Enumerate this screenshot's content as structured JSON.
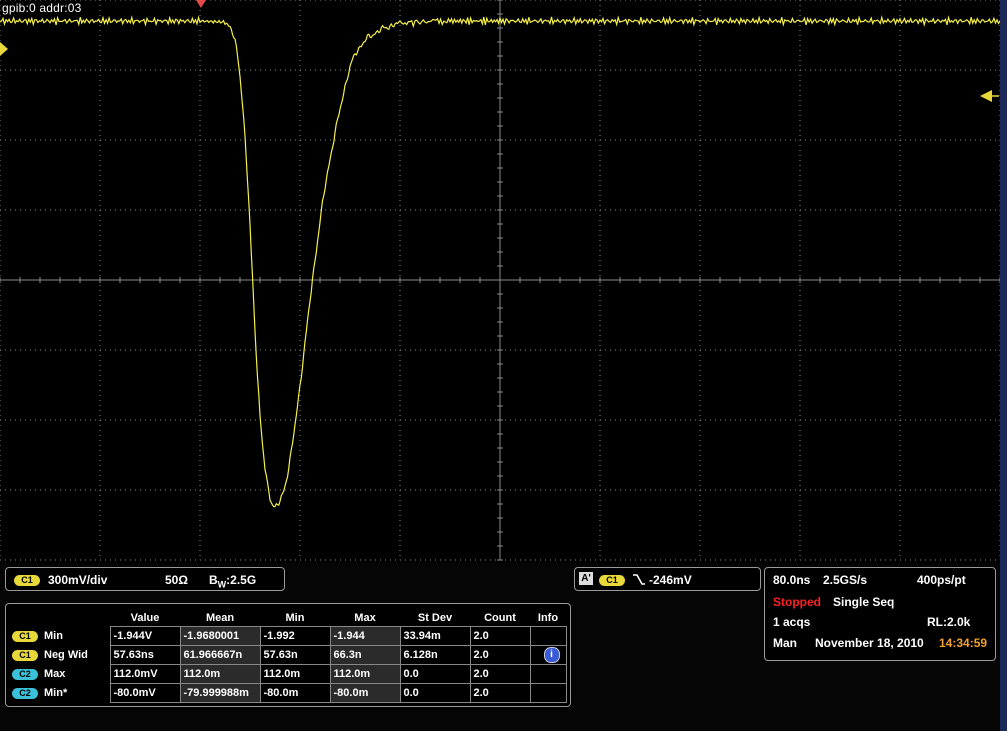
{
  "header": {
    "address": "gpib:0  addr:03"
  },
  "channel_panel": {
    "channel": "C1",
    "scale": "300mV/div",
    "impedance": "50Ω",
    "bw_prefix": "B",
    "bw_sub": "W",
    "bw_value": ":2.5G"
  },
  "trigger_panel": {
    "mode": "A'",
    "channel": "C1",
    "slope_icon": "falling-edge-icon",
    "level": "-246mV"
  },
  "acquisition_panel": {
    "timebase": "80.0ns",
    "sample_rate": "2.5GS/s",
    "resolution": "400ps/pt",
    "state": "Stopped",
    "state_color": "#ff2020",
    "mode": "Single Seq",
    "acqs": "1 acqs",
    "record_length": "RL:2.0k",
    "trigger_mode": "Man",
    "date": "November 18, 2010",
    "time": "14:34:59",
    "time_color": "#f0a030"
  },
  "measurements": {
    "headers": [
      "Value",
      "Mean",
      "Min",
      "Max",
      "St Dev",
      "Count",
      "Info"
    ],
    "rows": [
      {
        "channel": "C1",
        "name": "Min",
        "value": "-1.944V",
        "mean": "-1.9680001",
        "min": "-1.992",
        "max": "-1.944",
        "stdev": "33.94m",
        "count": "2.0",
        "info": ""
      },
      {
        "channel": "C1",
        "name": "Neg Wid",
        "value": "57.63ns",
        "mean": "61.966667n",
        "min": "57.63n",
        "max": "66.3n",
        "stdev": "6.128n",
        "count": "2.0",
        "info": "info-icon"
      },
      {
        "channel": "C2",
        "name": "Max",
        "value": "112.0mV",
        "mean": "112.0m",
        "min": "112.0m",
        "max": "112.0m",
        "stdev": "0.0",
        "count": "2.0",
        "info": ""
      },
      {
        "channel": "C2",
        "name": "Min*",
        "value": "-80.0mV",
        "mean": "-79.999988m",
        "min": "-80.0m",
        "max": "-80.0m",
        "stdev": "0.0",
        "count": "2.0",
        "info": ""
      }
    ]
  },
  "colors": {
    "trace": "#f5f04a",
    "grid": "#8a8a8a",
    "channel1": "#e8d83a",
    "channel2": "#3ac0d8"
  },
  "chart_data": {
    "type": "line",
    "title": "",
    "xlabel": "",
    "ylabel": "",
    "x_unit": "ns",
    "y_unit": "V",
    "xlim": [
      -200,
      600
    ],
    "ylim": [
      -2.4,
      2.4
    ],
    "grid": true,
    "series": [
      {
        "x": [
          -200,
          -160,
          -120,
          -80,
          -40,
          -20,
          -18,
          -16,
          -14,
          -12,
          -10,
          -8,
          -6,
          -4,
          -2,
          0,
          2,
          4,
          6,
          8,
          10,
          12,
          14,
          16,
          18,
          20,
          22,
          24,
          26,
          28,
          30,
          32,
          34,
          36,
          38,
          40,
          42,
          44,
          46,
          48,
          50,
          52,
          54,
          56,
          58,
          60,
          62,
          64,
          66,
          68,
          70,
          72,
          74,
          76,
          78,
          80,
          82,
          84,
          86,
          88,
          90,
          92,
          94,
          96,
          98,
          100,
          102,
          104,
          106,
          108,
          110,
          112,
          114,
          116,
          118,
          120,
          124,
          128,
          132,
          136,
          140,
          150,
          160,
          180,
          200,
          240,
          280,
          320,
          360,
          400,
          440,
          480,
          520,
          560,
          600
        ],
        "y": [
          2.22,
          2.22,
          2.22,
          2.22,
          2.22,
          2.21,
          2.2,
          2.17,
          2.12,
          2.04,
          1.92,
          1.75,
          1.52,
          1.22,
          0.86,
          0.46,
          0.02,
          -0.42,
          -0.82,
          -1.16,
          -1.42,
          -1.62,
          -1.76,
          -1.86,
          -1.92,
          -1.944,
          -1.935,
          -1.9,
          -1.84,
          -1.76,
          -1.66,
          -1.54,
          -1.4,
          -1.25,
          -1.08,
          -0.9,
          -0.72,
          -0.54,
          -0.36,
          -0.18,
          0.0,
          0.18,
          0.34,
          0.5,
          0.65,
          0.79,
          0.92,
          1.04,
          1.15,
          1.26,
          1.36,
          1.46,
          1.56,
          1.66,
          1.75,
          1.82,
          1.88,
          1.93,
          1.97,
          2.0,
          2.03,
          2.05,
          2.07,
          2.09,
          2.1,
          2.12,
          2.13,
          2.14,
          2.15,
          2.16,
          2.17,
          2.18,
          2.18,
          2.19,
          2.19,
          2.2,
          2.2,
          2.21,
          2.21,
          2.21,
          2.22,
          2.22,
          2.22,
          2.22,
          2.22,
          2.22,
          2.22,
          2.22,
          2.22,
          2.22,
          2.22,
          2.22,
          2.22,
          2.22,
          2.22
        ]
      }
    ]
  }
}
